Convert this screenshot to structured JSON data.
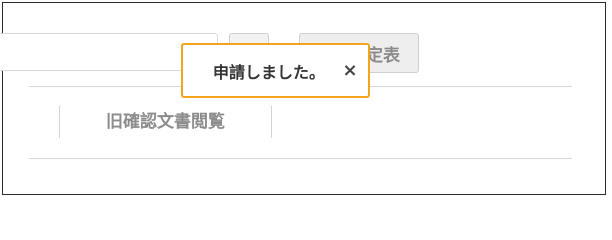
{
  "toolbar": {
    "search_value": "",
    "fixed_button_label": "定表"
  },
  "tabs": [
    {
      "label": "旧確認文書閲覧"
    }
  ],
  "toast": {
    "message": "申請しました。",
    "close_glyph": "×"
  },
  "colors": {
    "toast_border": "#f0a51a",
    "tab_text": "#8c8c8c",
    "frame_border": "#2b2b2b"
  }
}
